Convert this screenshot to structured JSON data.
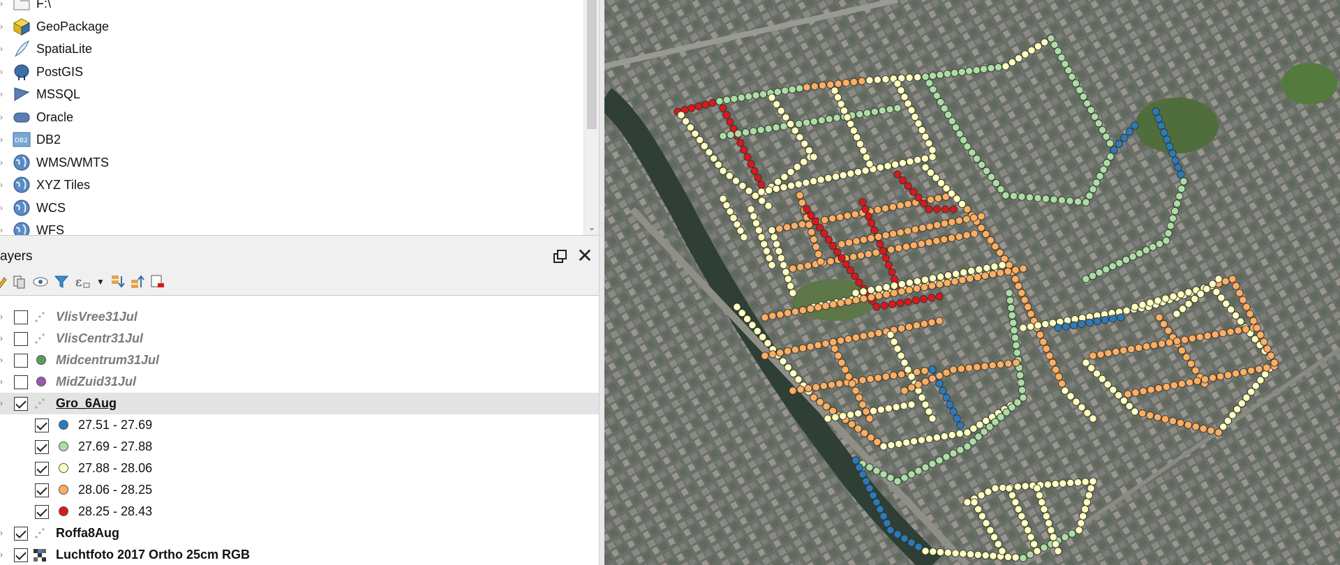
{
  "browser": {
    "items": [
      {
        "label": "F:\\",
        "icon": "folder-icon",
        "arrow": ""
      },
      {
        "label": "GeoPackage",
        "icon": "geopackage-icon",
        "arrow": ""
      },
      {
        "label": "SpatiaLite",
        "icon": "spatialite-feather-icon",
        "arrow": ""
      },
      {
        "label": "PostGIS",
        "icon": "postgis-elephant-icon",
        "arrow": ""
      },
      {
        "label": "MSSQL",
        "icon": "mssql-icon",
        "arrow": ""
      },
      {
        "label": "Oracle",
        "icon": "oracle-icon",
        "arrow": ""
      },
      {
        "label": "DB2",
        "icon": "db2-icon",
        "arrow": ""
      },
      {
        "label": "WMS/WMTS",
        "icon": "globe-icon",
        "arrow": ""
      },
      {
        "label": "XYZ Tiles",
        "icon": "globe-icon",
        "arrow": ""
      },
      {
        "label": "WCS",
        "icon": "globe-icon",
        "arrow": ""
      },
      {
        "label": "WFS",
        "icon": "globe-icon",
        "arrow": ""
      }
    ]
  },
  "layers_panel": {
    "title": "ayers",
    "toolbar_icons": [
      "style-icon",
      "add-group-icon",
      "manage-visibility-icon",
      "filter-legend-icon",
      "filter-expression-icon",
      "expand-all-icon",
      "collapse-all-icon",
      "remove-layer-icon"
    ]
  },
  "layer_tree": [
    {
      "label": "VlisVree31Jul",
      "checked": false,
      "style": "off",
      "symbol": "points"
    },
    {
      "label": "VlisCentr31Jul",
      "checked": false,
      "style": "off",
      "symbol": "points"
    },
    {
      "label": "Midcentrum31Jul",
      "checked": false,
      "style": "off",
      "symbol": "dot",
      "color": "#5d9c5d"
    },
    {
      "label": "MidZuid31Jul",
      "checked": false,
      "style": "off",
      "symbol": "dot",
      "color": "#9b59a8"
    },
    {
      "label": "Gro_6Aug",
      "checked": true,
      "style": "sel",
      "symbol": "points",
      "selected": true
    },
    {
      "label": "27.51 - 27.69",
      "checked": true,
      "style": "cls",
      "symbol": "dot",
      "color": "#2b7bb9",
      "child": true
    },
    {
      "label": "27.69 - 27.88",
      "checked": true,
      "style": "cls",
      "symbol": "dot",
      "color": "#abdda4",
      "child": true
    },
    {
      "label": "27.88 - 28.06",
      "checked": true,
      "style": "cls",
      "symbol": "dot",
      "color": "#ffffbf",
      "child": true
    },
    {
      "label": "28.06 - 28.25",
      "checked": true,
      "style": "cls",
      "symbol": "dot",
      "color": "#fdae61",
      "child": true
    },
    {
      "label": "28.25 - 28.43",
      "checked": true,
      "style": "cls",
      "symbol": "dot",
      "color": "#d7191c",
      "child": true
    },
    {
      "label": "Roffa8Aug",
      "checked": true,
      "style": "on",
      "symbol": "points"
    },
    {
      "label": "Luchtfoto 2017 Ortho 25cm RGB",
      "checked": true,
      "style": "on",
      "symbol": "raster"
    }
  ],
  "map": {
    "colors": {
      "blue": "#2b7bb9",
      "green": "#abdda4",
      "yellow": "#ffffbf",
      "orange": "#fdae61",
      "red": "#d7191c"
    }
  }
}
